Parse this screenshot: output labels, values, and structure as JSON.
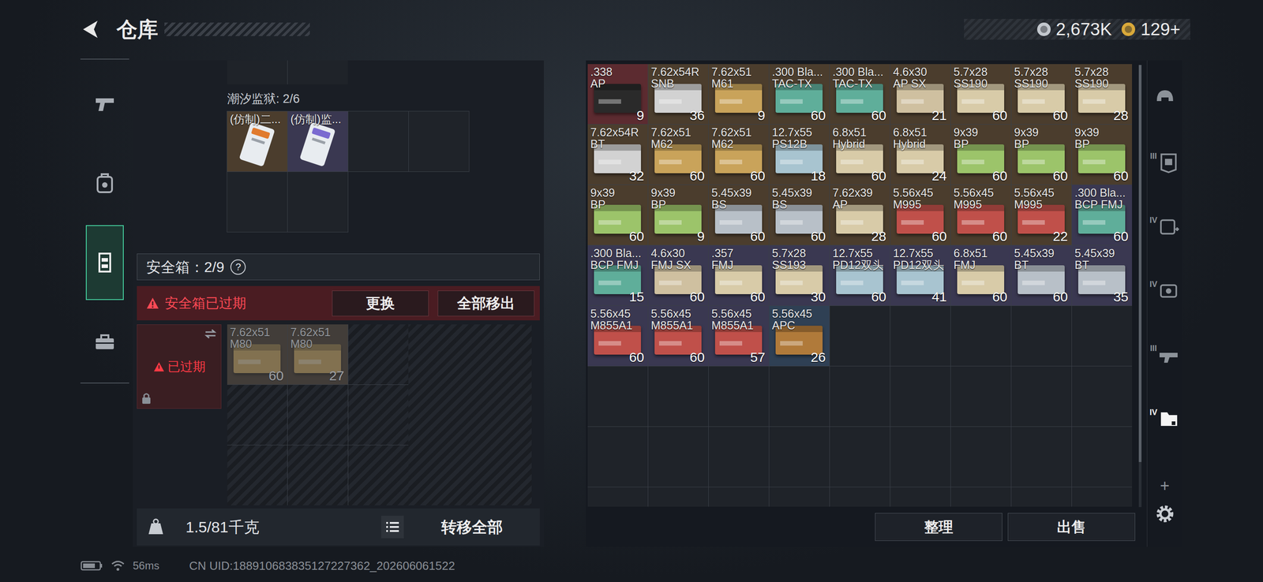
{
  "header": {
    "title": "仓库"
  },
  "currencies": [
    {
      "amount": "2,673K",
      "color": "#c3c8ce"
    },
    {
      "amount": "129+",
      "color": "#d9a93a"
    }
  ],
  "left_nav": [
    {
      "selected": false
    },
    {
      "selected": false
    },
    {
      "selected": true
    },
    {
      "selected": false
    }
  ],
  "prison_case": {
    "label": "潮汐监狱: 2/6",
    "slots": 6,
    "items": [
      {
        "name": "(仿制)二...",
        "color": "#4b3d2d",
        "card": "#e07a2e"
      },
      {
        "name": "(仿制)监...",
        "color": "#3a3851",
        "card": "#7a6ad0"
      }
    ]
  },
  "safebox": {
    "label": "安全箱：2/9",
    "help": "?",
    "warning": "安全箱已过期",
    "expired": true,
    "status": "已过期",
    "buttons": [
      "更换",
      "全部移出"
    ],
    "slots": 9,
    "items": [
      {
        "caliber": "7.62x51",
        "name": "M80",
        "count": "60",
        "color": "#4b3d2d",
        "box": "#c9a35a",
        "dimmed": true
      },
      {
        "caliber": "7.62x51",
        "name": "M80",
        "count": "27",
        "color": "#4b3d2d",
        "box": "#c9a35a",
        "dimmed": true
      }
    ]
  },
  "weight": {
    "reading": "1.5/81千克"
  },
  "transfer_all": "转移全部",
  "stash": {
    "buttons": [
      "整理",
      "出售"
    ],
    "items": [
      {
        "caliber": ".338",
        "name": "AP",
        "count": "9",
        "color": "#5c2b30",
        "box": "#2a2a2a"
      },
      {
        "caliber": "7.62x54R",
        "name": "SNB",
        "count": "36",
        "color": "#4b3d2d",
        "box": "#d2d2d2"
      },
      {
        "caliber": "7.62x51",
        "name": "M61",
        "count": "9",
        "color": "#4b3d2d",
        "box": "#c9a35a"
      },
      {
        "caliber": ".300 Bla...",
        "name": "TAC-TX",
        "count": "60",
        "color": "#4b3d2d",
        "box": "#5fae9a"
      },
      {
        "caliber": ".300 Bla...",
        "name": "TAC-TX",
        "count": "60",
        "color": "#4b3d2d",
        "box": "#5fae9a"
      },
      {
        "caliber": "4.6x30",
        "name": "AP SX",
        "count": "21",
        "color": "#4b3d2d",
        "box": "#cfc0a0"
      },
      {
        "caliber": "5.7x28",
        "name": "SS190",
        "count": "60",
        "color": "#4b3d2d",
        "box": "#d8cba8"
      },
      {
        "caliber": "5.7x28",
        "name": "SS190",
        "count": "60",
        "color": "#4b3d2d",
        "box": "#d8cba8"
      },
      {
        "caliber": "5.7x28",
        "name": "SS190",
        "count": "28",
        "color": "#4b3d2d",
        "box": "#d8cba8"
      },
      {
        "caliber": "7.62x54R",
        "name": "BT",
        "count": "32",
        "color": "#4b3d2d",
        "box": "#d2d2d2"
      },
      {
        "caliber": "7.62x51",
        "name": "M62",
        "count": "60",
        "color": "#4b3d2d",
        "box": "#c9a35a"
      },
      {
        "caliber": "7.62x51",
        "name": "M62",
        "count": "60",
        "color": "#4b3d2d",
        "box": "#c9a35a"
      },
      {
        "caliber": "12.7x55",
        "name": "PS12B",
        "count": "18",
        "color": "#4b3d2d",
        "box": "#a8c4d0"
      },
      {
        "caliber": "6.8x51",
        "name": "Hybrid",
        "count": "60",
        "color": "#4b3d2d",
        "box": "#d8cba8"
      },
      {
        "caliber": "6.8x51",
        "name": "Hybrid",
        "count": "24",
        "color": "#4b3d2d",
        "box": "#d8cba8"
      },
      {
        "caliber": "9x39",
        "name": "BP",
        "count": "60",
        "color": "#4b3d2d",
        "box": "#9cc46a"
      },
      {
        "caliber": "9x39",
        "name": "BP",
        "count": "60",
        "color": "#4b3d2d",
        "box": "#9cc46a"
      },
      {
        "caliber": "9x39",
        "name": "BP",
        "count": "60",
        "color": "#4b3d2d",
        "box": "#9cc46a"
      },
      {
        "caliber": "9x39",
        "name": "BP",
        "count": "60",
        "color": "#4b3d2d",
        "box": "#9cc46a"
      },
      {
        "caliber": "9x39",
        "name": "BP",
        "count": "9",
        "color": "#4b3d2d",
        "box": "#9cc46a"
      },
      {
        "caliber": "5.45x39",
        "name": "BS",
        "count": "60",
        "color": "#4b3d2d",
        "box": "#b8c0c8"
      },
      {
        "caliber": "5.45x39",
        "name": "BS",
        "count": "60",
        "color": "#4b3d2d",
        "box": "#b8c0c8"
      },
      {
        "caliber": "7.62x39",
        "name": "AP",
        "count": "28",
        "color": "#4b3d2d",
        "box": "#d8cba8"
      },
      {
        "caliber": "5.56x45",
        "name": "M995",
        "count": "60",
        "color": "#4b3d2d",
        "box": "#c0504a"
      },
      {
        "caliber": "5.56x45",
        "name": "M995",
        "count": "60",
        "color": "#4b3d2d",
        "box": "#c0504a"
      },
      {
        "caliber": "5.56x45",
        "name": "M995",
        "count": "22",
        "color": "#4b3d2d",
        "box": "#c0504a"
      },
      {
        "caliber": ".300 Bla...",
        "name": "BCP FMJ",
        "count": "60",
        "color": "#3a3851",
        "box": "#5fae9a"
      },
      {
        "caliber": ".300 Bla...",
        "name": "BCP FMJ",
        "count": "15",
        "color": "#3a3851",
        "box": "#5fae9a"
      },
      {
        "caliber": "4.6x30",
        "name": "FMJ SX",
        "count": "60",
        "color": "#3a3851",
        "box": "#cfc0a0"
      },
      {
        "caliber": ".357",
        "name": "FMJ",
        "count": "60",
        "color": "#3a3851",
        "box": "#d8cba8"
      },
      {
        "caliber": "5.7x28",
        "name": "SS193",
        "count": "30",
        "color": "#3a3851",
        "box": "#d8cba8"
      },
      {
        "caliber": "12.7x55",
        "name": "PD12双头",
        "count": "60",
        "color": "#3a3851",
        "box": "#a8c4d0"
      },
      {
        "caliber": "12.7x55",
        "name": "PD12双头",
        "count": "41",
        "color": "#3a3851",
        "box": "#a8c4d0"
      },
      {
        "caliber": "6.8x51",
        "name": "FMJ",
        "count": "60",
        "color": "#3a3851",
        "box": "#d8cba8"
      },
      {
        "caliber": "5.45x39",
        "name": "BT",
        "count": "60",
        "color": "#3a3851",
        "box": "#b8c0c8"
      },
      {
        "caliber": "5.45x39",
        "name": "BT",
        "count": "35",
        "color": "#3a3851",
        "box": "#b8c0c8"
      },
      {
        "caliber": "5.56x45",
        "name": "M855A1",
        "count": "60",
        "color": "#3a3851",
        "box": "#c0504a"
      },
      {
        "caliber": "5.56x45",
        "name": "M855A1",
        "count": "60",
        "color": "#3a3851",
        "box": "#c0504a"
      },
      {
        "caliber": "5.56x45",
        "name": "M855A1",
        "count": "57",
        "color": "#3a3851",
        "box": "#c0504a"
      },
      {
        "caliber": "5.56x45",
        "name": "APC",
        "count": "26",
        "color": "#2f4054",
        "box": "#b07a3a"
      }
    ]
  },
  "right_nav": [
    {
      "badge": "",
      "selected": false
    },
    {
      "badge": "III",
      "selected": false
    },
    {
      "badge": "IV",
      "selected": false
    },
    {
      "badge": "IV",
      "selected": false
    },
    {
      "badge": "III",
      "selected": false
    },
    {
      "badge": "IV",
      "selected": true
    }
  ],
  "right_nav_add": "+",
  "status_bar": {
    "ping": "56ms",
    "uid": "CN UID:188910683835127227362_202606061522"
  }
}
